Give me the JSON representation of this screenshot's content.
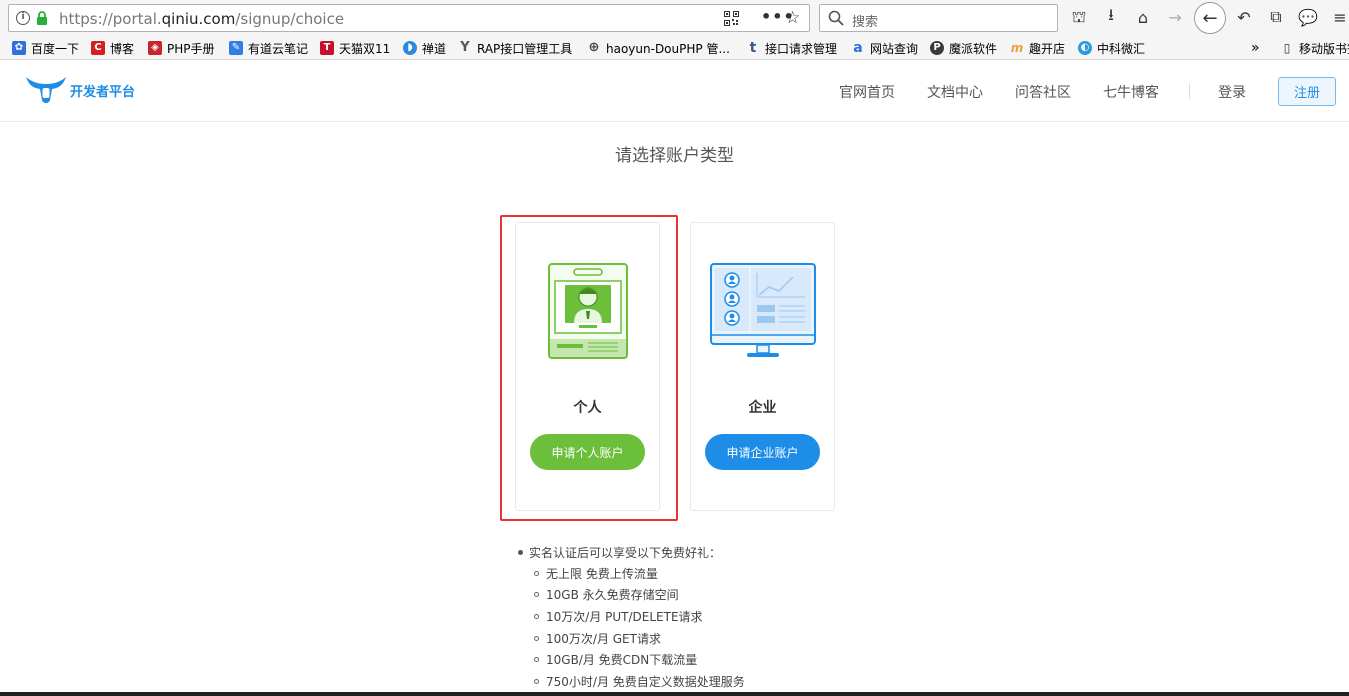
{
  "browser": {
    "url_prefix": "https://portal.",
    "url_domain": "qiniu.com",
    "url_path": "/signup/choice",
    "search_placeholder": "搜索",
    "bookmarks": [
      {
        "label": "百度一下",
        "color": "#2f6fde"
      },
      {
        "label": "博客",
        "color": "#d51f25"
      },
      {
        "label": "PHP手册",
        "color": "#c7262c"
      },
      {
        "label": "有道云笔记",
        "color": "#2f7fe6"
      },
      {
        "label": "天猫双11",
        "color": "#c8102e"
      },
      {
        "label": "禅道",
        "color": "#2a8ae0"
      },
      {
        "label": "RAP接口管理工具",
        "color": "#555555"
      },
      {
        "label": "haoyun-DouPHP 管...",
        "color": "#444444"
      },
      {
        "label": "接口请求管理",
        "color": "#3a5a80"
      },
      {
        "label": "网站查询",
        "color": "#2f6fde"
      },
      {
        "label": "魔派软件",
        "color": "#3a3a3a"
      },
      {
        "label": "趣开店",
        "color": "#e8a23a"
      },
      {
        "label": "中科微汇",
        "color": "#2a9adf"
      }
    ],
    "bookmarks_more": "»",
    "mobile_bookmarks": "移动版书签"
  },
  "header": {
    "logo_text": "开发者平台",
    "nav": [
      "官网首页",
      "文档中心",
      "问答社区",
      "七牛博客"
    ],
    "login": "登录",
    "register": "注册"
  },
  "main": {
    "title": "请选择账户类型",
    "cards": [
      {
        "label": "个人",
        "button": "申请个人账户",
        "accent": "#6bbf3a",
        "selected": true
      },
      {
        "label": "企业",
        "button": "申请企业账户",
        "accent": "#1e8de8",
        "selected": false
      }
    ],
    "benefits_lead": "实名认证后可以享受以下免费好礼：",
    "benefits": [
      "无上限 免费上传流量",
      "10GB 永久免费存储空间",
      "10万次/月 PUT/DELETE请求",
      "100万次/月 GET请求",
      "10GB/月 免费CDN下载流量",
      "750小时/月 免费自定义数据处理服务"
    ]
  },
  "colors": {
    "brand_blue": "#1e8de8",
    "personal_green": "#6bbf3a",
    "highlight_red": "#e63232"
  }
}
